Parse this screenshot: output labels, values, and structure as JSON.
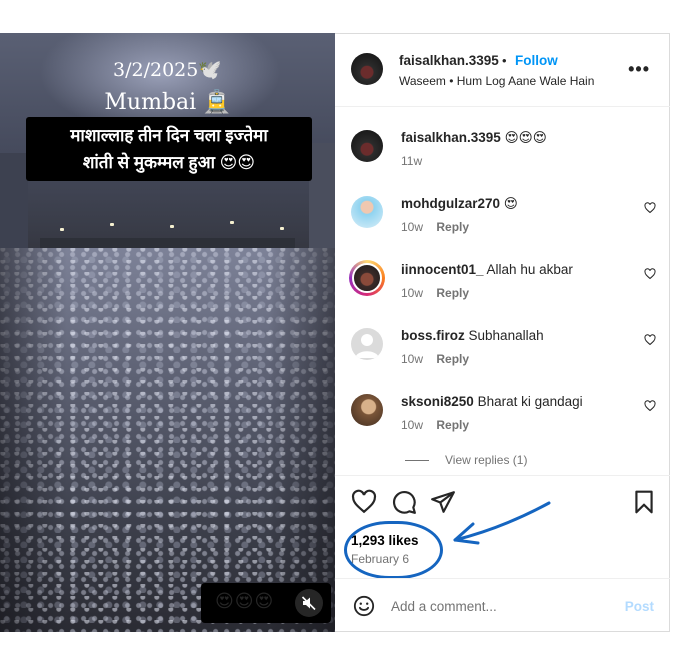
{
  "media": {
    "date_text": "3/2/2025🕊️",
    "city_text": "Mumbai 🚊",
    "caption_line1": "माशाल्लाह तीन दिन चला इज्तेमा",
    "caption_line2": "शांती से मुकम्मल हुआ 😍😍",
    "emoji_strip": "😍😍😍"
  },
  "header": {
    "username": "faisalkhan.3395",
    "separator": "•",
    "follow_label": "Follow",
    "audio_line": "Waseem • Hum Log Aane Wale Hain",
    "more_label": "•••"
  },
  "comments": [
    {
      "user": "faisalkhan.3395",
      "text": "😍😍😍",
      "time": "11w",
      "reply": ""
    },
    {
      "user": "mohdgulzar270",
      "text": "😍",
      "time": "10w",
      "reply": "Reply"
    },
    {
      "user": "iinnocent01_",
      "text": "Allah hu akbar",
      "time": "10w",
      "reply": "Reply"
    },
    {
      "user": "boss.firoz",
      "text": "Subhanallah",
      "time": "10w",
      "reply": "Reply"
    },
    {
      "user": "sksoni8250",
      "text": "Bharat ki gandagi",
      "time": "10w",
      "reply": "Reply"
    }
  ],
  "view_replies": "View replies (1)",
  "likes": "1,293 likes",
  "post_date": "February 6",
  "add_comment_placeholder": "Add a comment...",
  "post_label": "Post",
  "colors": {
    "accent": "#0095f6",
    "annotation": "#1565c0"
  }
}
